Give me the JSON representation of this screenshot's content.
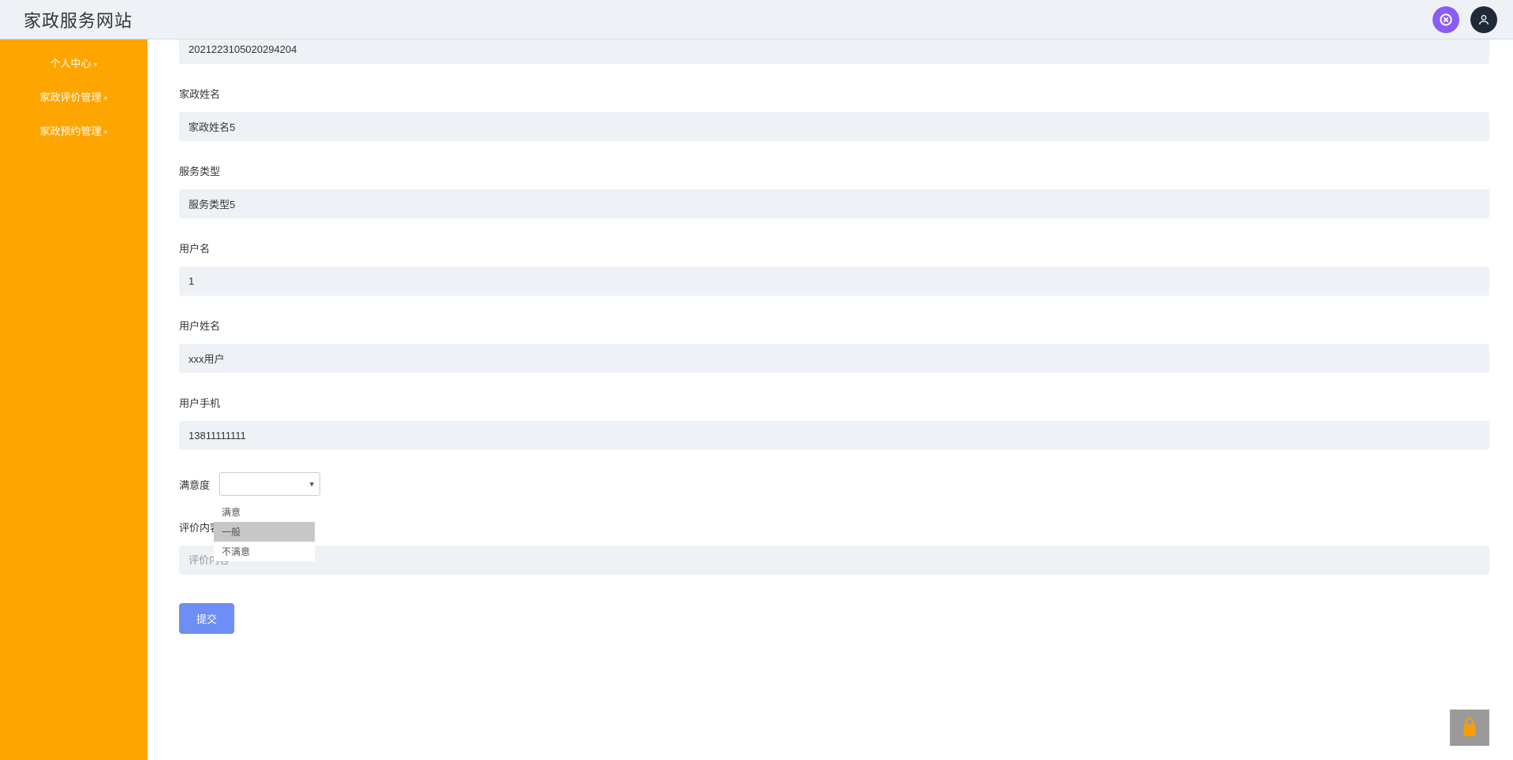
{
  "header": {
    "title": "家政服务网站"
  },
  "sidebar": {
    "items": [
      {
        "label": "个人中心"
      },
      {
        "label": "家政评价管理"
      },
      {
        "label": "家政预约管理"
      }
    ]
  },
  "form": {
    "order_no": {
      "value": "2021223105020294204"
    },
    "staff_name": {
      "label": "家政姓名",
      "value": "家政姓名5"
    },
    "service_type": {
      "label": "服务类型",
      "value": "服务类型5"
    },
    "username": {
      "label": "用户名",
      "value": "1"
    },
    "user_realname": {
      "label": "用户姓名",
      "value": "xxx用户"
    },
    "user_phone": {
      "label": "用户手机",
      "value": "13811111111"
    },
    "satisfaction": {
      "label": "满意度",
      "value": "",
      "options": [
        "满意",
        "一般",
        "不满意"
      ],
      "highlighted": "一般"
    },
    "review": {
      "label": "评价内容",
      "placeholder": "评价内容"
    },
    "submit": "提交"
  }
}
